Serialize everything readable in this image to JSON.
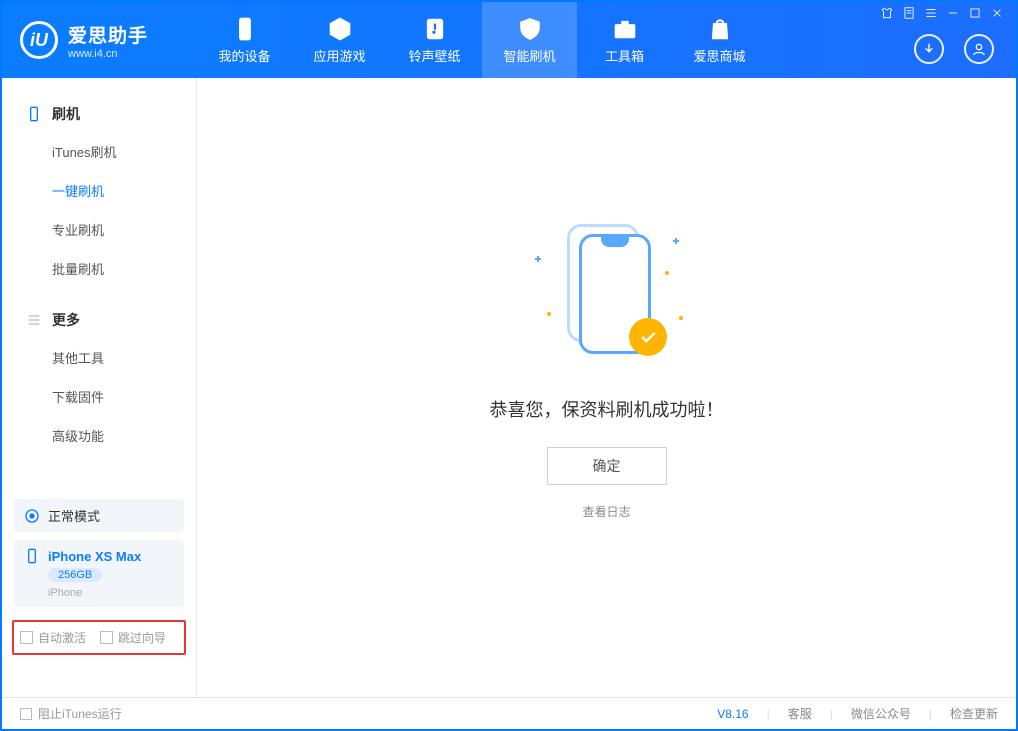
{
  "brand": {
    "cn": "爱思助手",
    "en": "www.i4.cn",
    "logo_letter": "iU"
  },
  "tabs": [
    {
      "label": "我的设备"
    },
    {
      "label": "应用游戏"
    },
    {
      "label": "铃声壁纸"
    },
    {
      "label": "智能刷机"
    },
    {
      "label": "工具箱"
    },
    {
      "label": "爱思商城"
    }
  ],
  "sidebar": {
    "group1": {
      "title": "刷机",
      "items": [
        "iTunes刷机",
        "一键刷机",
        "专业刷机",
        "批量刷机"
      ]
    },
    "group2": {
      "title": "更多",
      "items": [
        "其他工具",
        "下载固件",
        "高级功能"
      ]
    }
  },
  "device": {
    "mode": "正常模式",
    "name": "iPhone XS Max",
    "storage": "256GB",
    "type": "iPhone"
  },
  "options": {
    "auto_activate": "自动激活",
    "skip_guide": "跳过向导"
  },
  "main": {
    "message": "恭喜您，保资料刷机成功啦！",
    "ok": "确定",
    "log": "查看日志"
  },
  "footer": {
    "block_itunes": "阻止iTunes运行",
    "version": "V8.16",
    "support": "客服",
    "wechat": "微信公众号",
    "update": "检查更新"
  }
}
